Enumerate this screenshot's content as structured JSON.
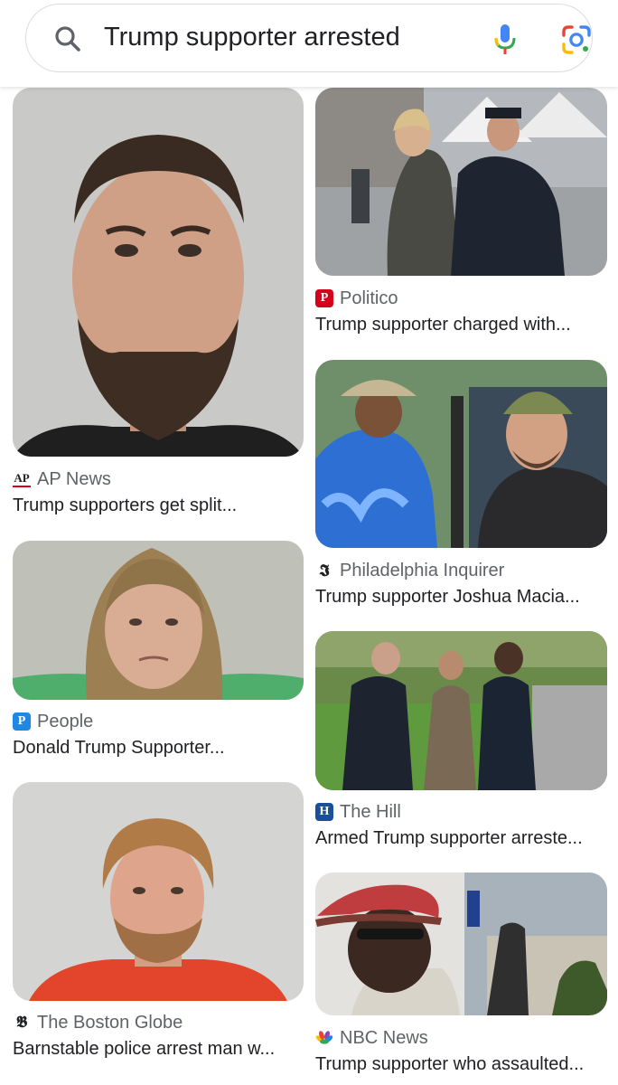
{
  "search": {
    "query": "Trump supporter arrested",
    "icons": [
      "search-icon",
      "microphone-icon",
      "google-lens-icon"
    ]
  },
  "results": [
    {
      "source": "AP News",
      "title": "Trump supporters get split...",
      "favicon": "ap-news-icon"
    },
    {
      "source": "Politico",
      "title": "Trump supporter charged with...",
      "favicon": "politico-icon"
    },
    {
      "source": "Philadelphia Inquirer",
      "title": "Trump supporter Joshua Macia...",
      "favicon": "philadelphia-inquirer-icon"
    },
    {
      "source": "People",
      "title": "Donald Trump Supporter...",
      "favicon": "people-icon"
    },
    {
      "source": "The Hill",
      "title": "Armed Trump supporter arreste...",
      "favicon": "the-hill-icon"
    },
    {
      "source": "The Boston Globe",
      "title": "Barnstable police arrest man w...",
      "favicon": "boston-globe-icon"
    },
    {
      "source": "NBC News",
      "title": "Trump supporter who assaulted...",
      "favicon": "nbc-news-icon"
    }
  ],
  "colors": {
    "politico": "#d6001c",
    "people": "#1e88e5",
    "the_hill": "#1a4fa0",
    "google_blue": "#4285f4",
    "google_red": "#ea4335",
    "google_yellow": "#fbbc05",
    "google_green": "#34a853"
  }
}
